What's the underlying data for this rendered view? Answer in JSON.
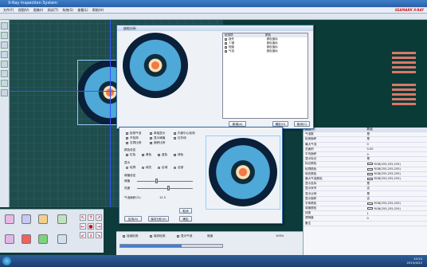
{
  "app": {
    "title": "X-Ray Inspection System",
    "banner": "SEAMARK X-RAY"
  },
  "menu": [
    "文件(F)",
    "视图(V)",
    "图像(I)",
    "测试(T)",
    "系统(S)",
    "查看(L)",
    "帮助(H)"
  ],
  "dialog1": {
    "title": "缺陷分析",
    "list_headers": [
      "检测项",
      "颜色"
    ],
    "items": [
      {
        "name": "缺失",
        "color": "颜色值标"
      },
      {
        "name": "少锡",
        "color": "颜色值标"
      },
      {
        "name": "短路",
        "color": "颜色值标"
      },
      {
        "name": "气泡",
        "color": "颜色值标"
      }
    ],
    "btn_add": "新增(A)",
    "btn_ok": "确定(O)",
    "btn_cancel": "取消(C)"
  },
  "dialog2": {
    "options": [
      "检测气泡",
      "单独显示",
      "内部中心检测",
      "不检测",
      "显示阈值",
      "红外线",
      "空洞比例",
      "面积比例"
    ],
    "section_color": "颜色设定",
    "colors": [
      "红色",
      "黄色",
      "蓝色",
      "绿色"
    ],
    "section_display": "显示",
    "display_opts": [
      "轮廓",
      "填充",
      "区域",
      "全部"
    ],
    "section_threshold": "阈值设定",
    "threshold_label": "阈值",
    "brightness_label": "亮度",
    "result_label": "气泡面积(%)",
    "result_value": "12.5",
    "btn_apply": "应用(A)",
    "btn_save": "保存分析(S)",
    "btn_ok": "确定",
    "btn_cancel": "取消"
  },
  "properties": {
    "rows": [
      {
        "k": "属性",
        "v": "数值"
      },
      {
        "k": "气泡数",
        "v": "是"
      },
      {
        "k": "检测面积",
        "v": "是"
      },
      {
        "k": "最大气泡",
        "v": "0"
      },
      {
        "k": "总面积",
        "v": "0.00"
      },
      {
        "k": "平均面积",
        "v": "0"
      },
      {
        "k": "显示标记",
        "v": "是"
      },
      {
        "k": "标记颜色",
        "v": "RGB(255,255,255)"
      },
      {
        "k": "轮廓颜色",
        "v": "RGB(255,255,255)"
      },
      {
        "k": "填充颜色",
        "v": "RGB(255,255,255)"
      },
      {
        "k": "最大气泡颜色",
        "v": "RGB(255,255,255)"
      },
      {
        "k": "显示坐标",
        "v": "是"
      },
      {
        "k": "显示序号",
        "v": "否"
      },
      {
        "k": "显示比例",
        "v": "是"
      },
      {
        "k": "显示面积",
        "v": "否"
      },
      {
        "k": "字体颜色",
        "v": "RGB(255,255,255)"
      },
      {
        "k": "背景颜色",
        "v": "RGB(255,255,255)"
      },
      {
        "k": "线宽",
        "v": "1"
      },
      {
        "k": "透明度",
        "v": "0"
      },
      {
        "k": "备注",
        "v": ""
      }
    ]
  },
  "bottom": {
    "labels": [
      "连续检测",
      "保存检测",
      "显示气泡"
    ],
    "status": "就绪",
    "zoom": "100%"
  },
  "taskbar": {
    "clock": "10:24",
    "date": "2015/4/22"
  },
  "colors": {
    "accent": "#2a5fa8",
    "pad": "#d9786a",
    "pcb": "#1f4d4d"
  }
}
